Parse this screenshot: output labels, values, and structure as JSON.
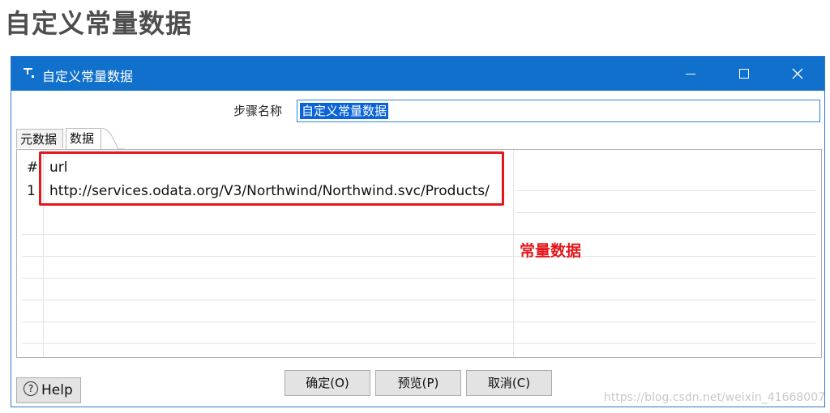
{
  "page": {
    "heading": "自定义常量数据"
  },
  "dialog": {
    "title": "自定义常量数据",
    "title_bar_color": "#1070cc"
  },
  "form": {
    "step_name_label": "步骤名称",
    "step_name_value": "自定义常量数据"
  },
  "tabs": [
    {
      "label": "元数据",
      "active": false
    },
    {
      "label": "数据",
      "active": true
    }
  ],
  "table": {
    "headers": [
      "#",
      "url"
    ],
    "rows": [
      {
        "index": "1",
        "url": "http://services.odata.org/V3/Northwind/Northwind.svc/Products/"
      }
    ]
  },
  "annotation": {
    "text": "常量数据",
    "color": "#e5171b"
  },
  "buttons": {
    "ok": "确定(O)",
    "preview": "预览(P)",
    "cancel": "取消(C)",
    "help": "Help"
  },
  "icons": {
    "app": "spoon-step-icon",
    "minimize": "minimize-icon",
    "maximize": "maximize-icon",
    "close": "close-icon",
    "help": "question-circle-icon"
  },
  "watermark": "https://blog.csdn.net/weixin_41668007"
}
